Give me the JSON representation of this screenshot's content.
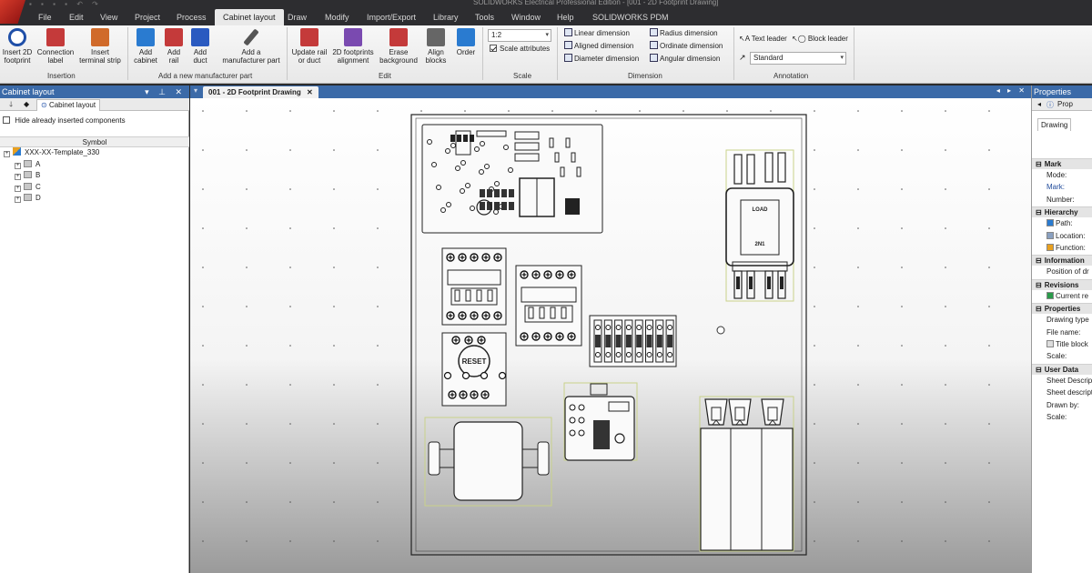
{
  "window": {
    "title": "SOLIDWORKS Electrical Professional Edition - [001 - 2D Footprint Drawing]"
  },
  "menu": {
    "items": [
      "File",
      "Edit",
      "View",
      "Project",
      "Process",
      "Cabinet layout",
      "Draw",
      "Modify",
      "Import/Export",
      "Library",
      "Tools",
      "Window",
      "Help",
      "SOLIDWORKS PDM"
    ],
    "active": "Cabinet layout"
  },
  "ribbon": {
    "insertion": {
      "label": "Insertion",
      "buttons": [
        {
          "l1": "Insert 2D",
          "l2": "footprint",
          "icon": "gear-icon",
          "color": "#1f4fa8"
        },
        {
          "l1": "Connection",
          "l2": "label",
          "icon": "connection-label-icon",
          "color": "#c43a3a"
        },
        {
          "l1": "Insert",
          "l2": "terminal strip",
          "icon": "terminal-strip-icon",
          "color": "#d06a2a"
        }
      ]
    },
    "manufacturer": {
      "label": "Add a new manufacturer part",
      "buttons": [
        {
          "l1": "Add",
          "l2": "cabinet",
          "icon": "cabinet-icon",
          "color": "#2a7bd0"
        },
        {
          "l1": "Add",
          "l2": "rail",
          "icon": "rail-icon",
          "color": "#c43a3a"
        },
        {
          "l1": "Add",
          "l2": "duct",
          "icon": "duct-icon",
          "color": "#2a5ac0"
        },
        {
          "l1": "Add a",
          "l2": "manufacturer part",
          "icon": "wrench-icon",
          "color": "#555555"
        }
      ]
    },
    "edit": {
      "label": "Edit",
      "buttons": [
        {
          "l1": "Update rail",
          "l2": "or duct",
          "icon": "update-rail-icon",
          "color": "#c43a3a"
        },
        {
          "l1": "2D footprints",
          "l2": "alignment",
          "icon": "alignment-icon",
          "color": "#7a4ab0"
        },
        {
          "l1": "Erase",
          "l2": "background",
          "icon": "erase-background-icon",
          "color": "#c43a3a"
        },
        {
          "l1": "Align",
          "l2": "blocks",
          "icon": "align-blocks-icon",
          "color": "#666666"
        },
        {
          "l1": "Order",
          "l2": "",
          "icon": "order-icon",
          "color": "#2a7bd0"
        }
      ]
    },
    "scale": {
      "label": "Scale",
      "value": "1:2",
      "attributes_label": "Scale attributes"
    },
    "dimension": {
      "label": "Dimension",
      "items": [
        "Linear dimension",
        "Aligned dimension",
        "Diameter dimension",
        "Radius dimension",
        "Ordinate dimension",
        "Angular dimension"
      ]
    },
    "annotation": {
      "label": "Annotation",
      "text_leader": "Text leader",
      "block_leader": "Block leader",
      "style": "Standard"
    }
  },
  "left_panel": {
    "title": "Cabinet layout",
    "tab": "Cabinet layout",
    "hide_label": "Hide already inserted components",
    "column": "Symbol",
    "tree": [
      "XXX-XX-Template_330",
      "A",
      "B",
      "C",
      "D"
    ]
  },
  "document": {
    "tab": "001 - 2D Footprint Drawing"
  },
  "properties": {
    "title": "Properties",
    "tab_prop": "Prop",
    "drawing_tab": "Drawing",
    "groups": [
      {
        "name": "Mark",
        "rows": [
          [
            "Mode:",
            ""
          ],
          [
            "Mark:",
            "blue"
          ],
          [
            "Number:",
            ""
          ]
        ]
      },
      {
        "name": "Hierarchy",
        "rows": [
          [
            "Path:",
            "path"
          ],
          [
            "Location:",
            "loc"
          ],
          [
            "Function:",
            "func"
          ]
        ]
      },
      {
        "name": "Information",
        "rows": [
          [
            "Position of dr",
            ""
          ]
        ]
      },
      {
        "name": "Revisions",
        "rows": [
          [
            "Current re",
            "rev"
          ]
        ]
      },
      {
        "name": "Properties",
        "rows": [
          [
            "Drawing type",
            ""
          ],
          [
            "File name:",
            ""
          ],
          [
            "Title block",
            "doc"
          ],
          [
            "Scale:",
            ""
          ]
        ]
      },
      {
        "name": "User Data",
        "rows": [
          [
            "Sheet Descrip",
            ""
          ],
          [
            "Sheet descript",
            ""
          ],
          [
            "Drawn by:",
            ""
          ],
          [
            "Scale:",
            ""
          ]
        ]
      }
    ]
  },
  "drawing": {
    "labels": {
      "load": "LOAD",
      "rating": "2N1",
      "reset": "RESET"
    }
  }
}
